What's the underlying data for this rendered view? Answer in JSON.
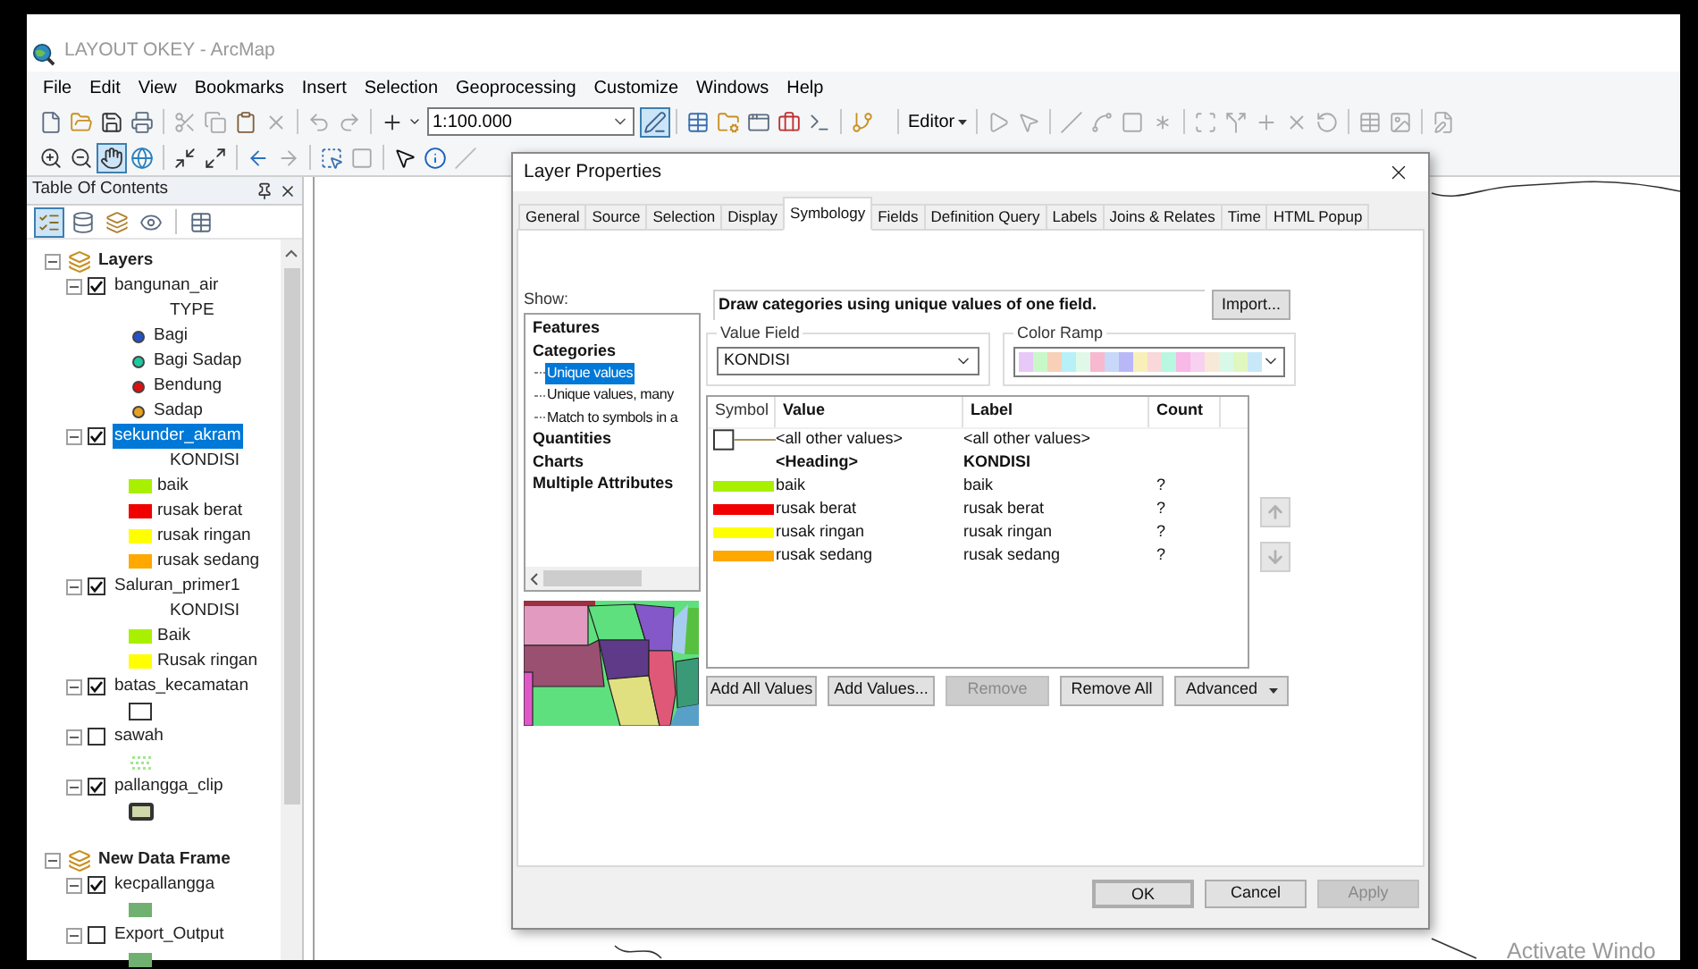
{
  "window": {
    "title": "LAYOUT OKEY - ArcMap"
  },
  "menu": [
    "File",
    "Edit",
    "View",
    "Bookmarks",
    "Insert",
    "Selection",
    "Geoprocessing",
    "Customize",
    "Windows",
    "Help"
  ],
  "toolbar": {
    "scale": "1:100.000",
    "editor": "Editor",
    "layout_tool_selected": true,
    "pan_tool_selected": true
  },
  "toc": {
    "title": "Table Of Contents",
    "drawing_order_selected": true,
    "frames": [
      {
        "name": "Layers",
        "expanded": true,
        "layers": [
          {
            "name": "bangunan_air",
            "checked": true,
            "selected": false,
            "expanded": true,
            "field": "TYPE",
            "legend": [
              {
                "kind": "point",
                "label": "Bagi",
                "color": "#2352c8"
              },
              {
                "kind": "point",
                "label": "Bagi Sadap",
                "color": "#20c8a0"
              },
              {
                "kind": "point",
                "label": "Bendung",
                "color": "#e01010"
              },
              {
                "kind": "point",
                "label": "Sadap",
                "color": "#e8a020"
              }
            ]
          },
          {
            "name": "sekunder_akram",
            "checked": true,
            "selected": true,
            "expanded": true,
            "field": "KONDISI",
            "legend": [
              {
                "kind": "patch",
                "label": "baik",
                "color": "#a8f000"
              },
              {
                "kind": "patch",
                "label": "rusak berat",
                "color": "#f00000"
              },
              {
                "kind": "patch",
                "label": "rusak ringan",
                "color": "#ffff00"
              },
              {
                "kind": "patch",
                "label": "rusak sedang",
                "color": "#ffa800"
              }
            ]
          },
          {
            "name": "Saluran_primer1",
            "checked": true,
            "selected": false,
            "expanded": true,
            "field": "KONDISI",
            "legend": [
              {
                "kind": "patch",
                "label": "Baik",
                "color": "#a8f000"
              },
              {
                "kind": "patch",
                "label": "Rusak ringan",
                "color": "#ffff00"
              }
            ]
          },
          {
            "name": "batas_kecamatan",
            "checked": true,
            "selected": false,
            "expanded": true,
            "legend": [
              {
                "kind": "outline",
                "color": "#ffffff"
              }
            ]
          },
          {
            "name": "sawah",
            "checked": false,
            "selected": false,
            "expanded": true,
            "legend": [
              {
                "kind": "pattern",
                "color": "#a0e890"
              }
            ]
          },
          {
            "name": "pallangga_clip",
            "checked": true,
            "selected": false,
            "expanded": true,
            "legend": [
              {
                "kind": "polygon",
                "color": "#cfd8a8"
              }
            ]
          }
        ]
      },
      {
        "name": "New Data Frame",
        "expanded": true,
        "layers": [
          {
            "name": "kecpallangga",
            "checked": true,
            "selected": false,
            "expanded": true,
            "legend": [
              {
                "kind": "patch",
                "color": "#70b070"
              }
            ]
          },
          {
            "name": "Export_Output",
            "checked": false,
            "selected": false,
            "expanded": true,
            "legend": [
              {
                "kind": "patch",
                "color": "#70b070"
              }
            ]
          }
        ]
      }
    ]
  },
  "dialog": {
    "title": "Layer Properties",
    "tabs": [
      {
        "label": "General",
        "selected": false
      },
      {
        "label": "Source",
        "selected": false
      },
      {
        "label": "Selection",
        "selected": false
      },
      {
        "label": "Display",
        "selected": false
      },
      {
        "label": "Symbology",
        "selected": true
      },
      {
        "label": "Fields",
        "selected": false
      },
      {
        "label": "Definition Query",
        "selected": false
      },
      {
        "label": "Labels",
        "selected": false
      },
      {
        "label": "Joins & Relates",
        "selected": false
      },
      {
        "label": "Time",
        "selected": false
      },
      {
        "label": "HTML Popup",
        "selected": false
      }
    ],
    "show_label": "Show:",
    "tree": [
      {
        "label": "Features",
        "selected": false
      },
      {
        "label": "Categories",
        "selected": false,
        "children": [
          {
            "label": "Unique values",
            "selected": true
          },
          {
            "label": "Unique values, many",
            "selected": false
          },
          {
            "label": "Match to symbols in a",
            "selected": false
          }
        ]
      },
      {
        "label": "Quantities",
        "selected": false
      },
      {
        "label": "Charts",
        "selected": false
      },
      {
        "label": "Multiple Attributes",
        "selected": false
      }
    ],
    "description": "Draw categories using unique values of one field.",
    "import_button": "Import...",
    "value_field": {
      "label": "Value Field",
      "value": "KONDISI"
    },
    "color_ramp": {
      "label": "Color Ramp"
    },
    "table": {
      "columns": [
        "Symbol",
        "Value",
        "Label",
        "Count"
      ],
      "rows": [
        {
          "kind": "other",
          "value": "<all other values>",
          "label": "<all other values>"
        },
        {
          "kind": "heading",
          "value": "<Heading>",
          "label": "KONDISI"
        },
        {
          "kind": "class",
          "color": "#a8f000",
          "value": "baik",
          "label": "baik",
          "count": "?"
        },
        {
          "kind": "class",
          "color": "#f00000",
          "value": "rusak berat",
          "label": "rusak berat",
          "count": "?"
        },
        {
          "kind": "class",
          "color": "#ffff00",
          "value": "rusak ringan",
          "label": "rusak ringan",
          "count": "?"
        },
        {
          "kind": "class",
          "color": "#ffa800",
          "value": "rusak sedang",
          "label": "rusak sedang",
          "count": "?"
        }
      ]
    },
    "actions": [
      {
        "label": "Add All Values",
        "disabled": false,
        "dropdown": false
      },
      {
        "label": "Add Values...",
        "disabled": false,
        "dropdown": false
      },
      {
        "label": "Remove",
        "disabled": true,
        "dropdown": false
      },
      {
        "label": "Remove All",
        "disabled": false,
        "dropdown": false
      },
      {
        "label": "Advanced",
        "disabled": false,
        "dropdown": true
      }
    ],
    "footer": [
      {
        "label": "OK",
        "default": true,
        "disabled": false
      },
      {
        "label": "Cancel",
        "default": false,
        "disabled": false
      },
      {
        "label": "Apply",
        "default": false,
        "disabled": true
      }
    ]
  },
  "watermark_text": "Activate Windo"
}
